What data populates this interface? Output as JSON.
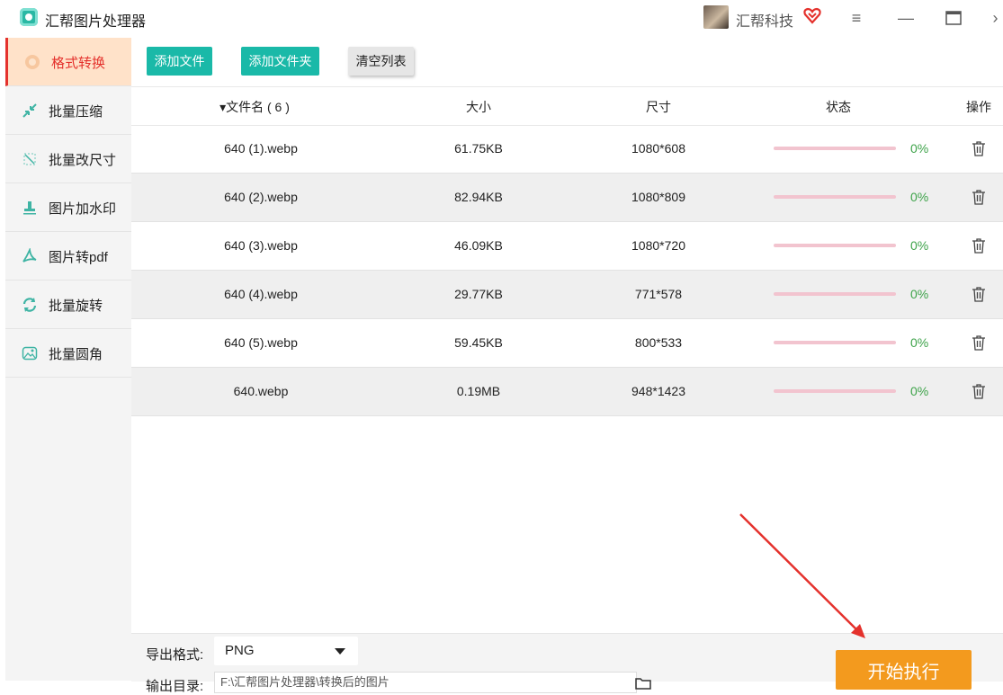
{
  "app": {
    "title": "汇帮图片处理器"
  },
  "user": {
    "name": "汇帮科技"
  },
  "window_controls": {
    "menu": "≡",
    "minimize": "—",
    "maximize": "▭",
    "more": "›"
  },
  "sidebar": {
    "items": [
      {
        "label": "格式转换",
        "icon": "format-convert-icon",
        "active": true
      },
      {
        "label": "批量压缩",
        "icon": "compress-icon",
        "active": false
      },
      {
        "label": "批量改尺寸",
        "icon": "resize-icon",
        "active": false
      },
      {
        "label": "图片加水印",
        "icon": "watermark-icon",
        "active": false
      },
      {
        "label": "图片转pdf",
        "icon": "pdf-icon",
        "active": false
      },
      {
        "label": "批量旋转",
        "icon": "rotate-icon",
        "active": false
      },
      {
        "label": "批量圆角",
        "icon": "round-corner-icon",
        "active": false
      }
    ]
  },
  "toolbar": {
    "add_file": "添加文件",
    "add_folder": "添加文件夹",
    "clear_list": "清空列表"
  },
  "table": {
    "headers": {
      "name": "▾文件名 ( 6 )",
      "size": "大小",
      "dimensions": "尺寸",
      "status": "状态",
      "action": "操作"
    },
    "rows": [
      {
        "name": "640 (1).webp",
        "size": "61.75KB",
        "dims": "1080*608",
        "progress": 0,
        "percent": "0%"
      },
      {
        "name": "640 (2).webp",
        "size": "82.94KB",
        "dims": "1080*809",
        "progress": 0,
        "percent": "0%"
      },
      {
        "name": "640 (3).webp",
        "size": "46.09KB",
        "dims": "1080*720",
        "progress": 0,
        "percent": "0%"
      },
      {
        "name": "640 (4).webp",
        "size": "29.77KB",
        "dims": "771*578",
        "progress": 0,
        "percent": "0%"
      },
      {
        "name": "640 (5).webp",
        "size": "59.45KB",
        "dims": "800*533",
        "progress": 0,
        "percent": "0%"
      },
      {
        "name": "640.webp",
        "size": "0.19MB",
        "dims": "948*1423",
        "progress": 0,
        "percent": "0%"
      }
    ]
  },
  "bottom": {
    "format_label": "导出格式:",
    "format_value": "PNG",
    "output_label": "输出目录:",
    "output_value": "F:\\汇帮图片处理器\\转换后的图片",
    "start_label": "开始执行"
  },
  "colors": {
    "accent_teal": "#1ab9a8",
    "active_red": "#e4312c",
    "start_orange": "#f39a1e",
    "progress_pink": "#f2c4cf",
    "percent_green": "#3ea34a"
  }
}
